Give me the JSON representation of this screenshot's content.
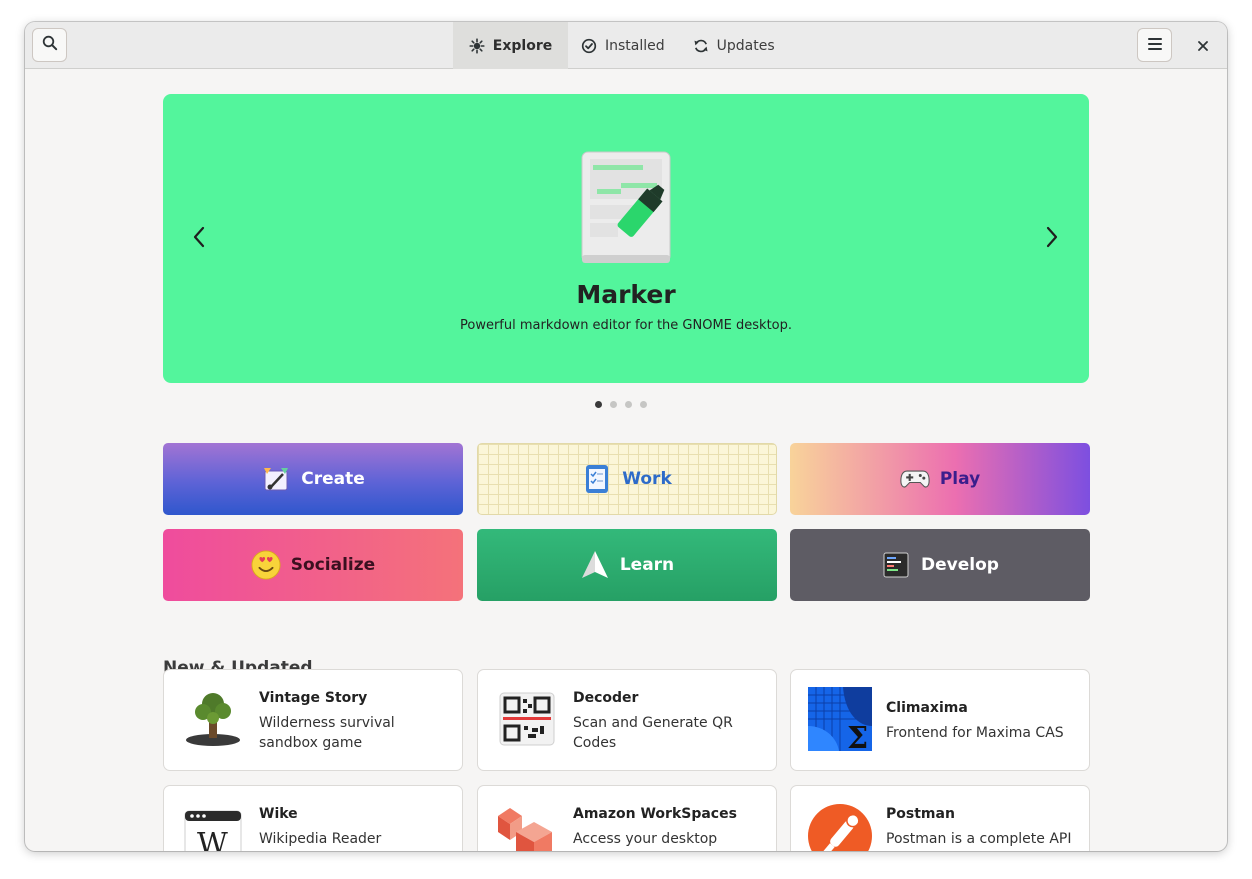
{
  "header": {
    "tabs": [
      {
        "label": "Explore",
        "icon": "explore-icon",
        "active": true
      },
      {
        "label": "Installed",
        "icon": "check-circle-icon",
        "active": false
      },
      {
        "label": "Updates",
        "icon": "refresh-icon",
        "active": false
      }
    ]
  },
  "banner": {
    "title": "Marker",
    "description": "Powerful markdown editor for the GNOME desktop.",
    "color": "#53f59c",
    "page_count": 4,
    "current_page": 1
  },
  "categories": [
    {
      "label": "Create",
      "icon": "create-icon"
    },
    {
      "label": "Work",
      "icon": "work-icon"
    },
    {
      "label": "Play",
      "icon": "gamepad-icon"
    },
    {
      "label": "Socialize",
      "icon": "smiley-icon"
    },
    {
      "label": "Learn",
      "icon": "paper-plane-icon"
    },
    {
      "label": "Develop",
      "icon": "terminal-icon"
    }
  ],
  "new_updated": {
    "title": "New & Updated",
    "apps": [
      {
        "name": "Vintage Story",
        "description": "Wilderness survival sandbox game",
        "icon": "vintage-story-icon"
      },
      {
        "name": "Decoder",
        "description": "Scan and Generate QR Codes",
        "icon": "qr-code-icon"
      },
      {
        "name": "Climaxima",
        "description": "Frontend for Maxima CAS",
        "icon": "sigma-icon"
      },
      {
        "name": "Wike",
        "description": "Wikipedia Reader",
        "icon": "wikipedia-icon"
      },
      {
        "name": "Amazon WorkSpaces",
        "description": "Access your desktop",
        "icon": "workspaces-icon"
      },
      {
        "name": "Postman",
        "description": "Postman is a complete API",
        "icon": "postman-icon"
      }
    ]
  }
}
